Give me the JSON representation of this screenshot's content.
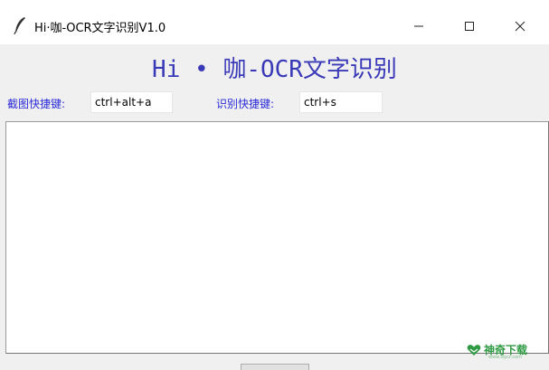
{
  "window": {
    "title": "Hi·咖-OCR文字识别V1.0",
    "icon": "feather-icon",
    "controls": {
      "minimize": "minimize-icon",
      "maximize": "maximize-icon",
      "close": "close-icon"
    }
  },
  "header": {
    "title": "Hi • 咖-OCR文字识别"
  },
  "hotkeys": {
    "screenshot_label": "截图快捷键:",
    "screenshot_value": "ctrl+alt+a",
    "recognize_label": "识别快捷键:",
    "recognize_value": "ctrl+s"
  },
  "result": {
    "text": ""
  },
  "watermark": {
    "text": "神奇下载",
    "sub": "www.sqxz.com"
  },
  "colors": {
    "heading": "#3a3ab8",
    "label": "#2a2ad8",
    "watermark": "#2f9a43"
  }
}
